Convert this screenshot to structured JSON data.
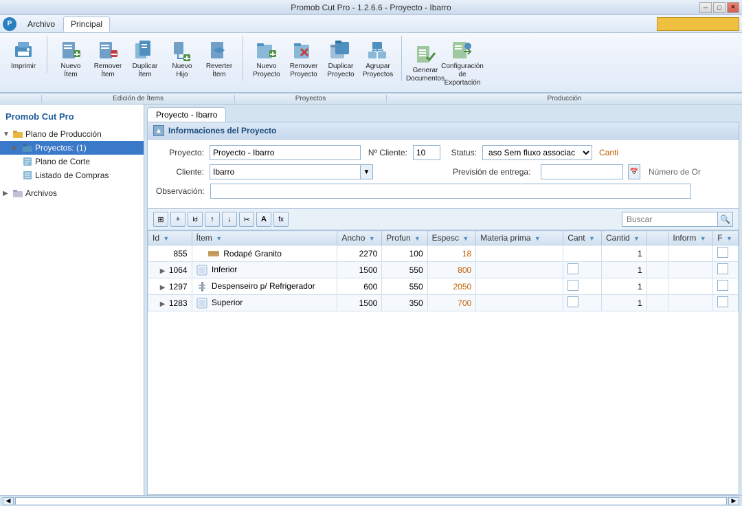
{
  "window": {
    "title": "Promob Cut Pro - 1.2.6.6 - Proyecto - Ibarro",
    "logo": "P"
  },
  "titlebar": {
    "minimize": "─",
    "restore": "□",
    "close": "✕"
  },
  "menu": {
    "items": [
      {
        "label": "Archivo",
        "active": false
      },
      {
        "label": "Principal",
        "active": true
      }
    ]
  },
  "toolbar": {
    "groups": [
      {
        "name": "",
        "buttons": [
          {
            "label": "Imprimir",
            "icon": "print"
          }
        ]
      },
      {
        "name": "Edición de Ítems",
        "buttons": [
          {
            "label": "Nuevo Ítem",
            "icon": "new-item"
          },
          {
            "label": "Remover Ítem",
            "icon": "remove-item"
          },
          {
            "label": "Duplicar Ítem",
            "icon": "duplicate-item"
          },
          {
            "label": "Nuevo Hijo",
            "icon": "new-child"
          },
          {
            "label": "Reverter Ítem",
            "icon": "revert-item"
          }
        ]
      },
      {
        "name": "Proyectos",
        "buttons": [
          {
            "label": "Nuevo Proyecto",
            "icon": "new-project"
          },
          {
            "label": "Remover Proyecto",
            "icon": "remove-project"
          },
          {
            "label": "Duplicar Proyecto",
            "icon": "duplicate-project"
          },
          {
            "label": "Agrupar Proyectos",
            "icon": "group-projects"
          }
        ]
      },
      {
        "name": "Producción",
        "buttons": [
          {
            "label": "Generar Documentos",
            "icon": "generate-docs"
          },
          {
            "label": "Configuración de Exportación",
            "icon": "export-config"
          }
        ]
      }
    ]
  },
  "sidebar": {
    "title": "Promob Cut Pro",
    "tree": [
      {
        "level": 0,
        "label": "Plano de Producción",
        "icon": "folder",
        "expanded": true
      },
      {
        "level": 1,
        "label": "Proyectos: (1)",
        "icon": "folder-blue",
        "selected": true,
        "expanded": false
      },
      {
        "level": 2,
        "label": "Plano de Corte",
        "icon": "cut-plan"
      },
      {
        "level": 2,
        "label": "Listado de Compras",
        "icon": "list"
      },
      {
        "level": 0,
        "label": "Archivos",
        "icon": "archive",
        "expanded": false
      }
    ]
  },
  "tab": {
    "label": "Proyecto - Ibarro"
  },
  "project_info": {
    "section_title": "Informaciones del Proyecto",
    "fields": {
      "proyecto_label": "Proyecto:",
      "proyecto_value": "Proyecto - Ibarro",
      "no_cliente_label": "Nº Cliente:",
      "no_cliente_value": "10",
      "status_label": "Status:",
      "status_value": "aso Sem fluxo associac",
      "canti_label": "Canti",
      "cliente_label": "Cliente:",
      "cliente_value": "Ibarro",
      "prev_entrega_label": "Previsión de entrega:",
      "numero_or_label": "Número de Or",
      "observacion_label": "Observación:"
    }
  },
  "grid_toolbar": {
    "buttons": [
      "⊞",
      "+",
      "Id",
      "↑",
      "↓",
      "✂",
      "A",
      "fx"
    ],
    "search_placeholder": "Buscar"
  },
  "table": {
    "columns": [
      {
        "label": "Id",
        "filterable": true
      },
      {
        "label": "Ítem",
        "filterable": true
      },
      {
        "label": "Ancho",
        "filterable": true
      },
      {
        "label": "Profun",
        "filterable": true
      },
      {
        "label": "Espesc",
        "filterable": true
      },
      {
        "label": "Materia prima",
        "filterable": true
      },
      {
        "label": "Cant",
        "filterable": true
      },
      {
        "label": "Cantid",
        "filterable": true
      },
      {
        "label": "",
        "filterable": false
      },
      {
        "label": "Inform",
        "filterable": true
      },
      {
        "label": "F",
        "filterable": true
      }
    ],
    "rows": [
      {
        "id": "855",
        "expandable": false,
        "item_icon": "wood",
        "item": "Rodapé Granito",
        "ancho": "2270",
        "profun": "100",
        "espesc": "18",
        "materia": "",
        "cant": "",
        "cantid": "1",
        "extra": "",
        "inform": "",
        "f": false
      },
      {
        "id": "1064",
        "expandable": true,
        "item_icon": "component",
        "item": "Inferior",
        "ancho": "1500",
        "profun": "550",
        "espesc": "800",
        "materia": "",
        "cant": "checkbox",
        "cantid": "1",
        "extra": "",
        "inform": "",
        "f": false
      },
      {
        "id": "1297",
        "expandable": true,
        "item_icon": "bar",
        "item": "Despenseiro p/ Refrigerador",
        "ancho": "600",
        "profun": "550",
        "espesc": "2050",
        "materia": "",
        "cant": "checkbox",
        "cantid": "1",
        "extra": "",
        "inform": "",
        "f": false
      },
      {
        "id": "1283",
        "expandable": true,
        "item_icon": "component",
        "item": "Superior",
        "ancho": "1500",
        "profun": "350",
        "espesc": "700",
        "materia": "",
        "cant": "checkbox",
        "cantid": "1",
        "extra": "",
        "inform": "",
        "f": false
      }
    ]
  },
  "colors": {
    "accent_blue": "#1a5a9a",
    "header_bg": "#dce8f5",
    "border": "#aac0d8",
    "selected": "#3a78c9",
    "orange": "#c06000"
  }
}
